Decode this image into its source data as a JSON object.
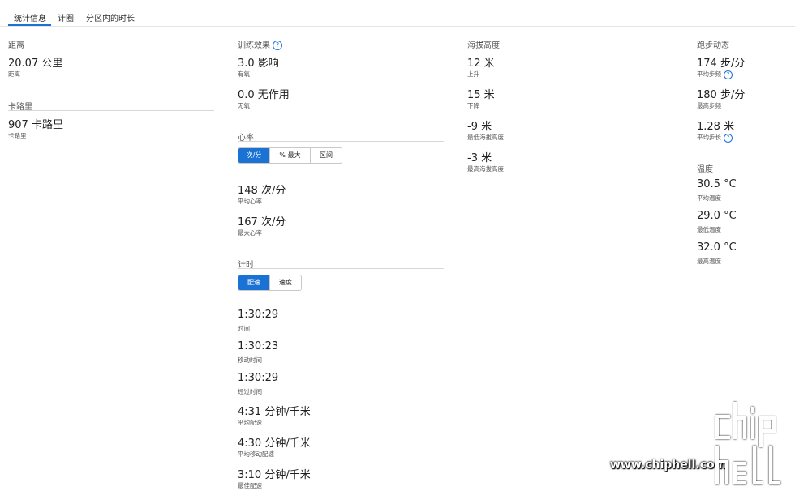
{
  "tabs": [
    {
      "label": "统计信息",
      "active": true
    },
    {
      "label": "计圈",
      "active": false
    },
    {
      "label": "分区内的时长",
      "active": false
    }
  ],
  "col1": {
    "distance": {
      "title": "距离",
      "value": "20.07 公里",
      "label": "距离"
    },
    "calories": {
      "title": "卡路里",
      "value": "907 卡路里",
      "label": "卡路里"
    }
  },
  "col2": {
    "training": {
      "title": "训练效果",
      "aerobic_value": "3.0 影响",
      "aerobic_label": "有氧",
      "anaerobic_value": "0.0 无作用",
      "anaerobic_label": "无氧"
    },
    "heart_rate": {
      "title": "心率",
      "options": [
        "次/分",
        "% 最大",
        "区间"
      ],
      "selected": "次/分",
      "avg_value": "148 次/分",
      "avg_label": "平均心率",
      "max_value": "167 次/分",
      "max_label": "最大心率"
    },
    "timing": {
      "title": "计时",
      "options": [
        "配速",
        "速度"
      ],
      "selected": "配速",
      "items": [
        {
          "value": "1:30:29",
          "label": "时间"
        },
        {
          "value": "1:30:23",
          "label": "移动时间"
        },
        {
          "value": "1:30:29",
          "label": "经过时间"
        },
        {
          "value": "4:31 分钟/千米",
          "label": "平均配速"
        },
        {
          "value": "4:30 分钟/千米",
          "label": "平均移动配速"
        },
        {
          "value": "3:10 分钟/千米",
          "label": "最佳配速"
        }
      ]
    }
  },
  "col3": {
    "elevation": {
      "title": "海拔高度",
      "items": [
        {
          "value": "12 米",
          "label": "上升"
        },
        {
          "value": "15 米",
          "label": "下降"
        },
        {
          "value": "-9 米",
          "label": "最低海拔高度"
        },
        {
          "value": "-3 米",
          "label": "最高海拔高度"
        }
      ]
    }
  },
  "col4": {
    "running_dynamics": {
      "title": "跑步动态",
      "items": [
        {
          "value": "174 步/分",
          "label": "平均步频"
        },
        {
          "value": "180 步/分",
          "label": "最高步频"
        },
        {
          "value": "1.28 米",
          "label": "平均步长"
        }
      ]
    },
    "temperature": {
      "title": "温度",
      "items": [
        {
          "value": "30.5 °C",
          "label": "平均温度"
        },
        {
          "value": "29.0 °C",
          "label": "最低温度"
        },
        {
          "value": "32.0 °C",
          "label": "最高温度"
        }
      ]
    }
  },
  "watermark": {
    "url": "www.chiphell.com",
    "logo_text": "chip hell"
  },
  "colors": {
    "accent": "#1a73d4",
    "rule": "#d8d8d8",
    "text": "#222222",
    "label": "#555555"
  }
}
